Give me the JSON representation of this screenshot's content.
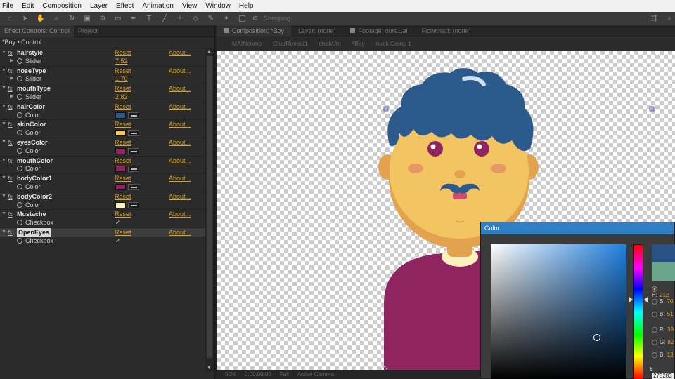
{
  "menu": [
    "File",
    "Edit",
    "Composition",
    "Layer",
    "Effect",
    "Animation",
    "View",
    "Window",
    "Help"
  ],
  "toolbar": {
    "snapping_label": "Snapping"
  },
  "effect_controls": {
    "tabs": [
      "Effect Controls: Control",
      "Project"
    ],
    "title": "*Boy • Control",
    "effects": [
      {
        "name": "hairstyle",
        "reset": "Reset",
        "about": "About...",
        "param": "Slider",
        "kind": "slider",
        "value": "7,52"
      },
      {
        "name": "noseType",
        "reset": "Reset",
        "about": "About...",
        "param": "Slider",
        "kind": "slider",
        "value": "1,70"
      },
      {
        "name": "mouthType",
        "reset": "Reset",
        "about": "About...",
        "param": "Slider",
        "kind": "slider",
        "value": "2,82"
      },
      {
        "name": "hairColor",
        "reset": "Reset",
        "about": "About...",
        "param": "Color",
        "kind": "color",
        "color": "#2c5a8c"
      },
      {
        "name": "skinColor",
        "reset": "Reset",
        "about": "About...",
        "param": "Color",
        "kind": "color",
        "color": "#f3c462"
      },
      {
        "name": "eyesColor",
        "reset": "Reset",
        "about": "About...",
        "param": "Color",
        "kind": "color",
        "color": "#8f2461"
      },
      {
        "name": "mouthColor",
        "reset": "Reset",
        "about": "About...",
        "param": "Color",
        "kind": "color",
        "color": "#8f2461"
      },
      {
        "name": "bodyColor1",
        "reset": "Reset",
        "about": "About...",
        "param": "Color",
        "kind": "color",
        "color": "#8f2461"
      },
      {
        "name": "bodyColor2",
        "reset": "Reset",
        "about": "About...",
        "param": "Color",
        "kind": "color",
        "color": "#fbf1c0"
      },
      {
        "name": "Mustache",
        "reset": "Reset",
        "about": "About...",
        "param": "Checkbox",
        "kind": "checkbox",
        "checked": "✓"
      },
      {
        "name": "OpenEyes",
        "reset": "Reset",
        "about": "About...",
        "param": "Checkbox",
        "kind": "checkbox",
        "checked": "✓",
        "selected": true
      }
    ]
  },
  "composition": {
    "tabs": [
      "Composition: *Boy",
      "Layer: (none)",
      "Footage: ours1.ai",
      "Flowchart: (none)"
    ],
    "flow": [
      "MAINcomp",
      "CharReveal1",
      "chaMAn",
      "*Boy",
      "neck Comp 1"
    ],
    "footer": [
      "50%",
      "0;00;00;00",
      "Full",
      "Active Camera"
    ]
  },
  "character_colors": {
    "hair": "#2c5a8c",
    "skin": "#f3c462",
    "skin_shadow": "#e3a24d",
    "cheek": "#e59a63",
    "eye": "#8f2461",
    "mustache": "#2c5a8c",
    "mouth": "#d14b6f",
    "body": "#8f2461",
    "collar": "#fbf1c0"
  },
  "color_picker": {
    "title": "Color",
    "new_color": "#275283",
    "old_color": "#6aa58a",
    "fields": [
      {
        "label": "H:",
        "value": "212",
        "selected": true
      },
      {
        "label": "S:",
        "value": "70"
      },
      {
        "label": "B:",
        "value": "51"
      },
      {
        "label": "R:",
        "value": "39"
      },
      {
        "label": "G:",
        "value": "82"
      },
      {
        "label": "B:",
        "value": "13"
      }
    ],
    "hex_label": "#",
    "hex_value": "275283"
  }
}
